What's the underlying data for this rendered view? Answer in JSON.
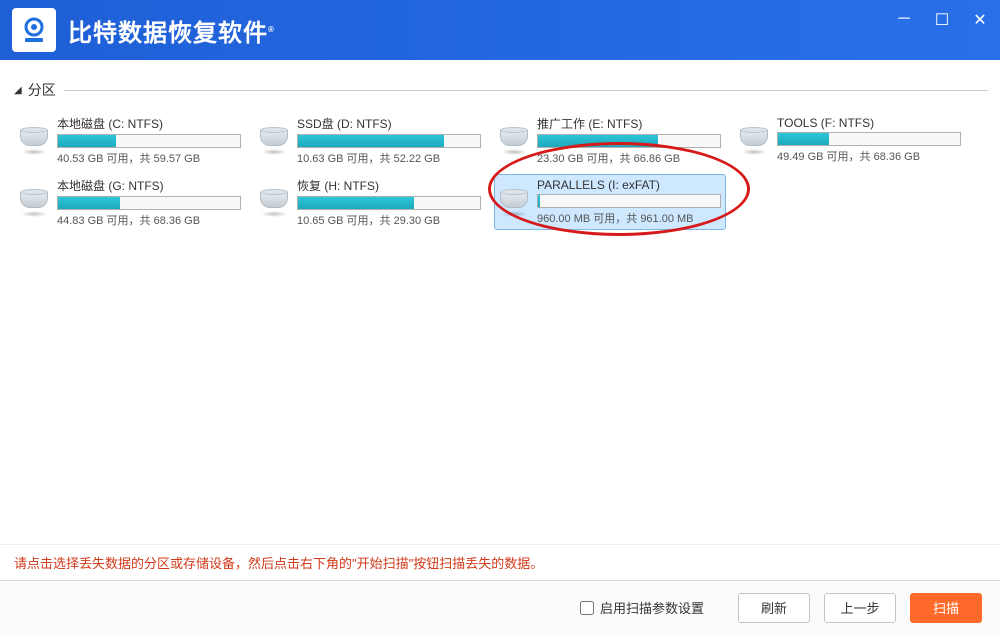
{
  "app": {
    "title": "比特数据恢复软件"
  },
  "section": {
    "label": "分区"
  },
  "partitions": [
    {
      "name": "本地磁盘 (C: NTFS)",
      "usage_text": "40.53 GB 可用，共 59.57 GB",
      "fill_pct": 32
    },
    {
      "name": "SSD盘 (D: NTFS)",
      "usage_text": "10.63 GB 可用，共 52.22 GB",
      "fill_pct": 80
    },
    {
      "name": "推广工作 (E: NTFS)",
      "usage_text": "23.30 GB 可用，共 66.86 GB",
      "fill_pct": 66
    },
    {
      "name": "TOOLS (F: NTFS)",
      "usage_text": "49.49 GB 可用，共 68.36 GB",
      "fill_pct": 28
    },
    {
      "name": "本地磁盘 (G: NTFS)",
      "usage_text": "44.83 GB 可用，共 68.36 GB",
      "fill_pct": 34
    },
    {
      "name": "恢复 (H: NTFS)",
      "usage_text": "10.65 GB 可用，共 29.30 GB",
      "fill_pct": 64
    },
    {
      "name": "PARALLELS (I: exFAT)",
      "usage_text": "960.00 MB 可用，共 961.00 MB",
      "fill_pct": 1
    }
  ],
  "selected_index": 6,
  "hint": "请点击选择丢失数据的分区或存储设备，然后点击右下角的\"开始扫描\"按钮扫描丢失的数据。",
  "footer": {
    "checkbox_label": "启用扫描参数设置",
    "refresh": "刷新",
    "prev": "上一步",
    "scan": "扫描"
  }
}
